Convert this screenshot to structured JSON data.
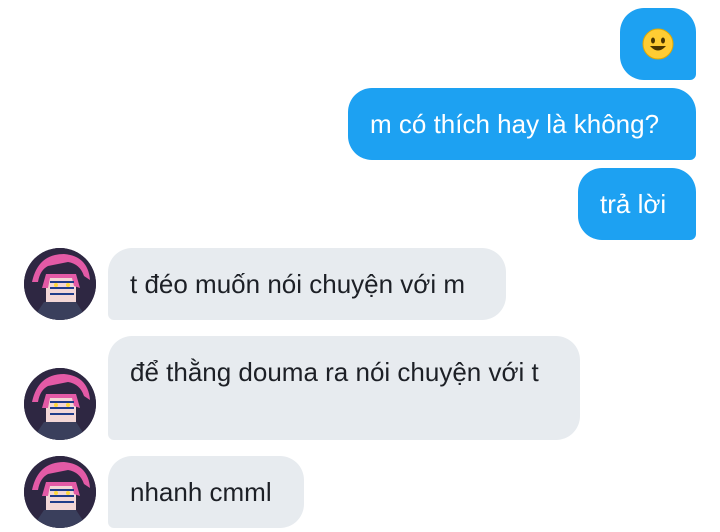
{
  "messages": {
    "outgoing": [
      {
        "text": "🙂",
        "emoji": "smiley-face-icon"
      },
      {
        "text": "m có thích hay là không?"
      },
      {
        "text": "trả lời"
      }
    ],
    "incoming": [
      {
        "text": "t đéo muốn nói chuyện với m"
      },
      {
        "text": "để thằng douma ra nói chuyện với t"
      },
      {
        "text": "nhanh cmml"
      }
    ]
  },
  "colors": {
    "outgoing_bubble": "#1da1f2",
    "incoming_bubble": "#e7ebef",
    "background": "#ffffff"
  },
  "avatar": {
    "icon": "anime-character-avatar"
  }
}
